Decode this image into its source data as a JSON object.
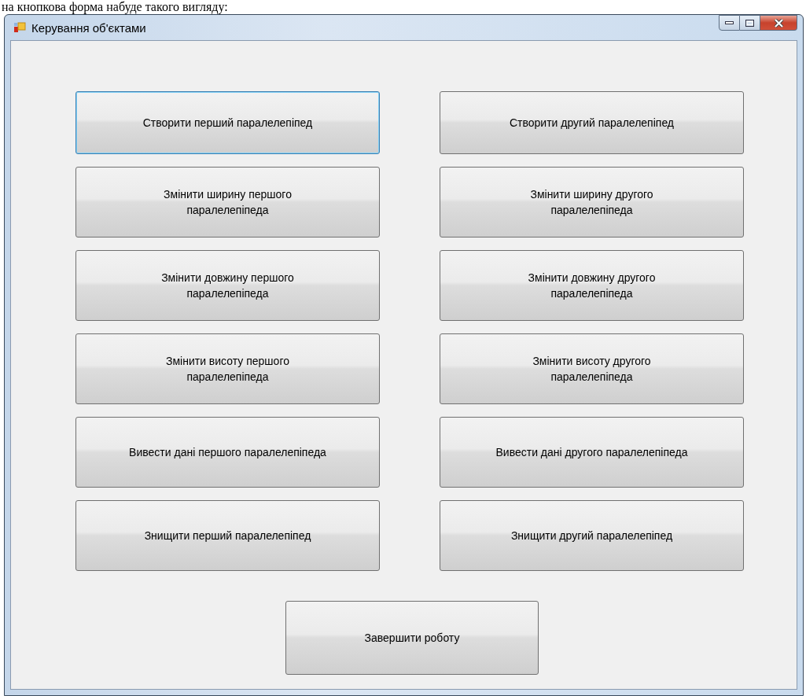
{
  "caption": "на кнопкова форма набуде такого вигляду:",
  "window": {
    "title": "Керування об'єктами"
  },
  "buttons": [
    {
      "label": "Створити перший паралелепіпед",
      "focused": true
    },
    {
      "label": "Створити другий паралелепіпед",
      "focused": false
    },
    {
      "label": "Змінити ширину першого паралелепіпеда",
      "focused": false
    },
    {
      "label": "Змінити ширину другого паралелепіпеда",
      "focused": false
    },
    {
      "label": "Змінити довжину першого паралелепіпеда",
      "focused": false
    },
    {
      "label": "Змінити довжину другого паралелепіпеда",
      "focused": false
    },
    {
      "label": "Змінити висоту першого паралелепіпеда",
      "focused": false
    },
    {
      "label": "Змінити висоту другого паралелепіпеда",
      "focused": false
    },
    {
      "label": "Вивести дані першого паралелепіпеда",
      "focused": false
    },
    {
      "label": "Вивести дані другого паралелепіпеда",
      "focused": false
    },
    {
      "label": "Знищити перший паралелепіпед",
      "focused": false
    },
    {
      "label": "Знищити другий паралелепіпед",
      "focused": false
    }
  ],
  "exit_button": {
    "label": "Завершити роботу",
    "focused": false
  }
}
